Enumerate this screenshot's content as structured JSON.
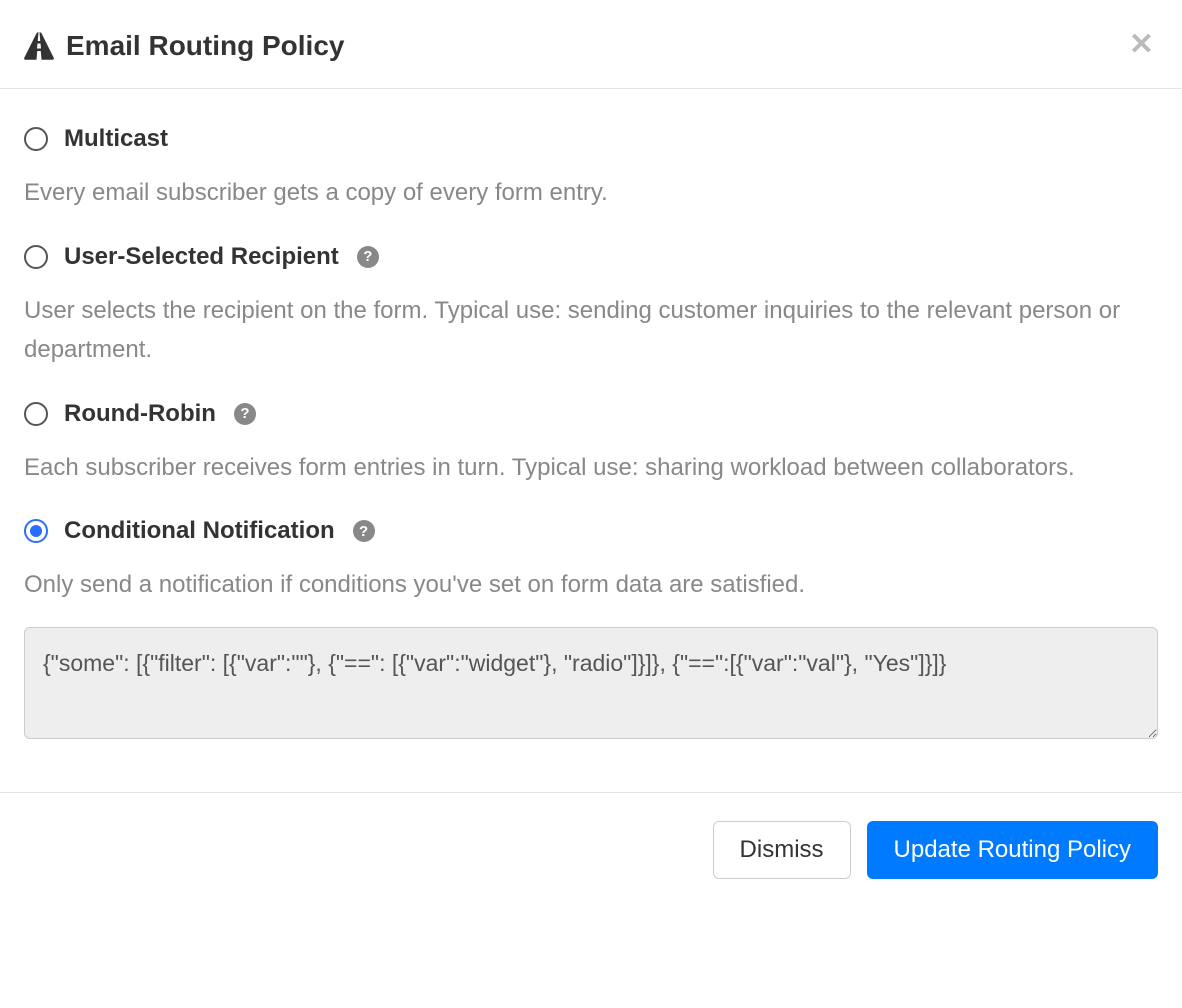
{
  "header": {
    "title": "Email Routing Policy"
  },
  "options": [
    {
      "label": "Multicast",
      "description": "Every email subscriber gets a copy of every form entry.",
      "has_help": false,
      "checked": false
    },
    {
      "label": "User-Selected Recipient",
      "description": "User selects the recipient on the form. Typical use: sending customer inquiries to the relevant person or department.",
      "has_help": true,
      "checked": false
    },
    {
      "label": "Round-Robin",
      "description": "Each subscriber receives form entries in turn. Typical use: sharing workload between collaborators.",
      "has_help": true,
      "checked": false
    },
    {
      "label": "Conditional Notification",
      "description": "Only send a notification if conditions you've set on form data are satisfied.",
      "has_help": true,
      "checked": true
    }
  ],
  "code_area": {
    "value": "{\"some\": [{\"filter\": [{\"var\":\"\"}, {\"==\": [{\"var\":\"widget\"}, \"radio\"]}]}, {\"==\":[{\"var\":\"val\"}, \"Yes\"]}]}"
  },
  "footer": {
    "dismiss_label": "Dismiss",
    "submit_label": "Update Routing Policy"
  }
}
